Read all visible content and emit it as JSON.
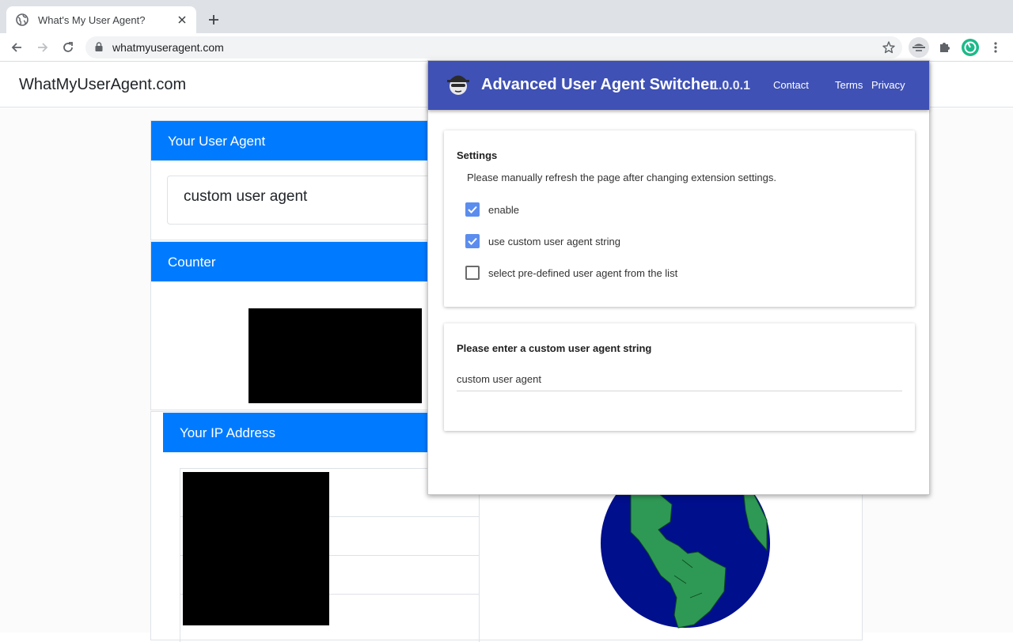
{
  "browser": {
    "tab_title": "What's My User Agent?",
    "url": "whatmyuseragent.com"
  },
  "site": {
    "brand": "WhatMyUserAgent.com",
    "cards": {
      "user_agent_title": "Your User Agent",
      "user_agent_value": "custom user agent",
      "counter_title": "Counter",
      "ip_title": "Your IP Address"
    }
  },
  "popup": {
    "title": "Advanced User Agent Switcher",
    "version": "1.0.0.1",
    "links": [
      "Contact",
      "Terms",
      "Privacy"
    ],
    "settings": {
      "title": "Settings",
      "note": "Please manually refresh the page after changing extension settings.",
      "options": [
        {
          "label": "enable",
          "checked": true
        },
        {
          "label": "use custom user agent string",
          "checked": true
        },
        {
          "label": "select pre-defined user agent from the list",
          "checked": false
        }
      ]
    },
    "custom": {
      "title": "Please enter a custom user agent string",
      "value": "custom user agent"
    }
  },
  "colors": {
    "card_header": "#007bff",
    "popup_header": "#3f51b5",
    "checkbox_on": "#5b8def",
    "ocean": "#000f8c",
    "land": "#2e9954"
  }
}
